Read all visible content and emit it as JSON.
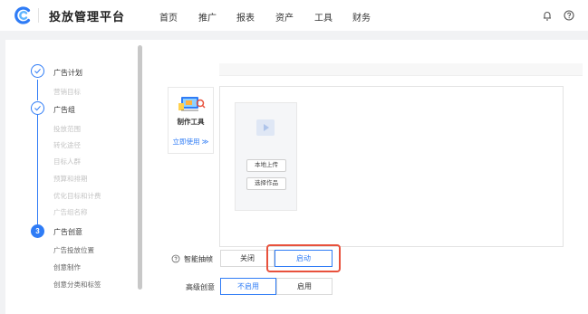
{
  "app": {
    "title": "投放管理平台"
  },
  "nav": [
    {
      "label": "首页"
    },
    {
      "label": "推广"
    },
    {
      "label": "报表"
    },
    {
      "label": "资产"
    },
    {
      "label": "工具"
    },
    {
      "label": "财务"
    }
  ],
  "steps": [
    {
      "label": "广告计划",
      "state": "done",
      "subs": [
        "营销目标"
      ]
    },
    {
      "label": "广告组",
      "state": "done",
      "subs": [
        "投放范围",
        "转化途径",
        "目标人群",
        "预算和排期",
        "优化目标和计费",
        "广告组名称"
      ]
    },
    {
      "label": "广告创意",
      "state": "current",
      "number": "3",
      "subs": [
        "广告投放位置",
        "创意制作",
        "创意分类和标签"
      ]
    }
  ],
  "tool": {
    "name": "制作工具",
    "link": "立即使用 ≫"
  },
  "upload": {
    "local_upload": "本地上传",
    "choose_work": "选择作品"
  },
  "smart_frame": {
    "label": "智能抽帧",
    "off": "关闭",
    "on": "启动",
    "selected": "启动"
  },
  "advanced_creative": {
    "label": "高级创意",
    "disabled": "不启用",
    "enabled": "启用",
    "selected": "不启用"
  },
  "colors": {
    "primary": "#2f7cf6",
    "highlight": "#e8513c",
    "background": "#f1f2f4"
  }
}
